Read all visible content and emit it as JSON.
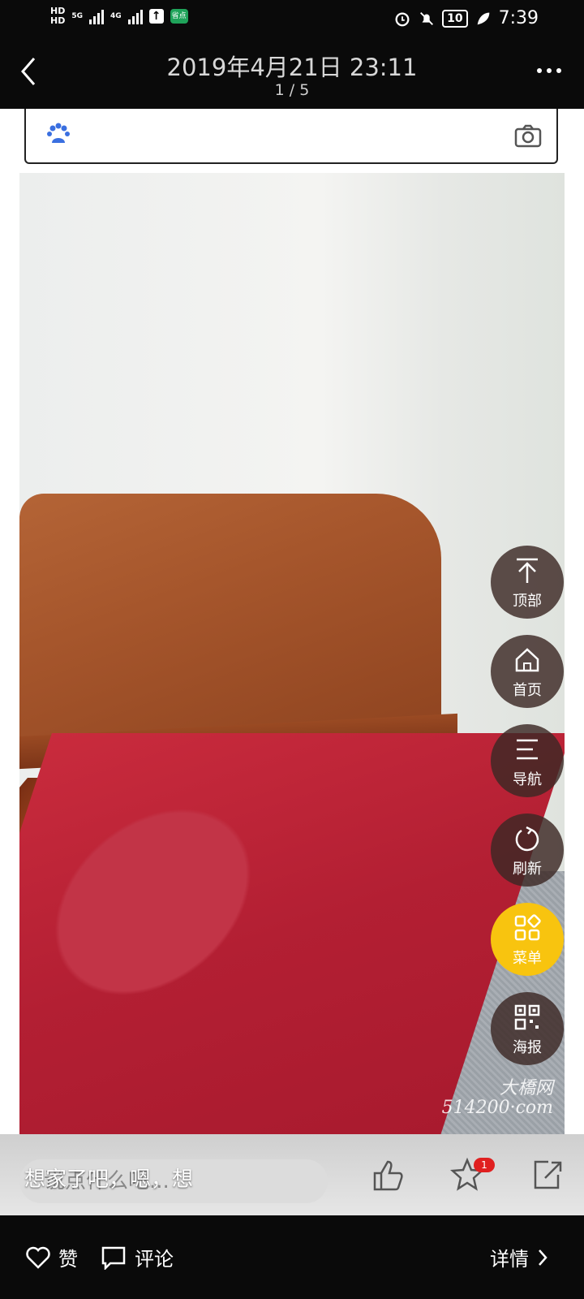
{
  "status_bar": {
    "hd1": "HD",
    "hd2": "HD",
    "net1": "5G",
    "net2": "4G",
    "app_badge": "省点",
    "battery": "10",
    "time": "7:39"
  },
  "header": {
    "title": "2019年4月21日 23:11",
    "pager": "1 / 5"
  },
  "photo": {
    "watermark_line1": "大橋网",
    "watermark_line2": "514200·com"
  },
  "side_menu": [
    {
      "label": "顶部",
      "icon": "arrow-top-icon"
    },
    {
      "label": "首页",
      "icon": "home-icon"
    },
    {
      "label": "导航",
      "icon": "menu-lines-icon"
    },
    {
      "label": "刷新",
      "icon": "refresh-icon"
    },
    {
      "label": "菜单",
      "icon": "grid-icon"
    },
    {
      "label": "海报",
      "icon": "qrcode-icon"
    }
  ],
  "comment": {
    "caption": "想家了吧，嗯，想",
    "placeholder": "说点什么吧...",
    "favorites_badge": "1"
  },
  "actions": {
    "like": "赞",
    "comment": "评论",
    "details": "详情"
  },
  "colors": {
    "accent_yellow": "#f8c40f",
    "badge_red": "#e02020"
  }
}
